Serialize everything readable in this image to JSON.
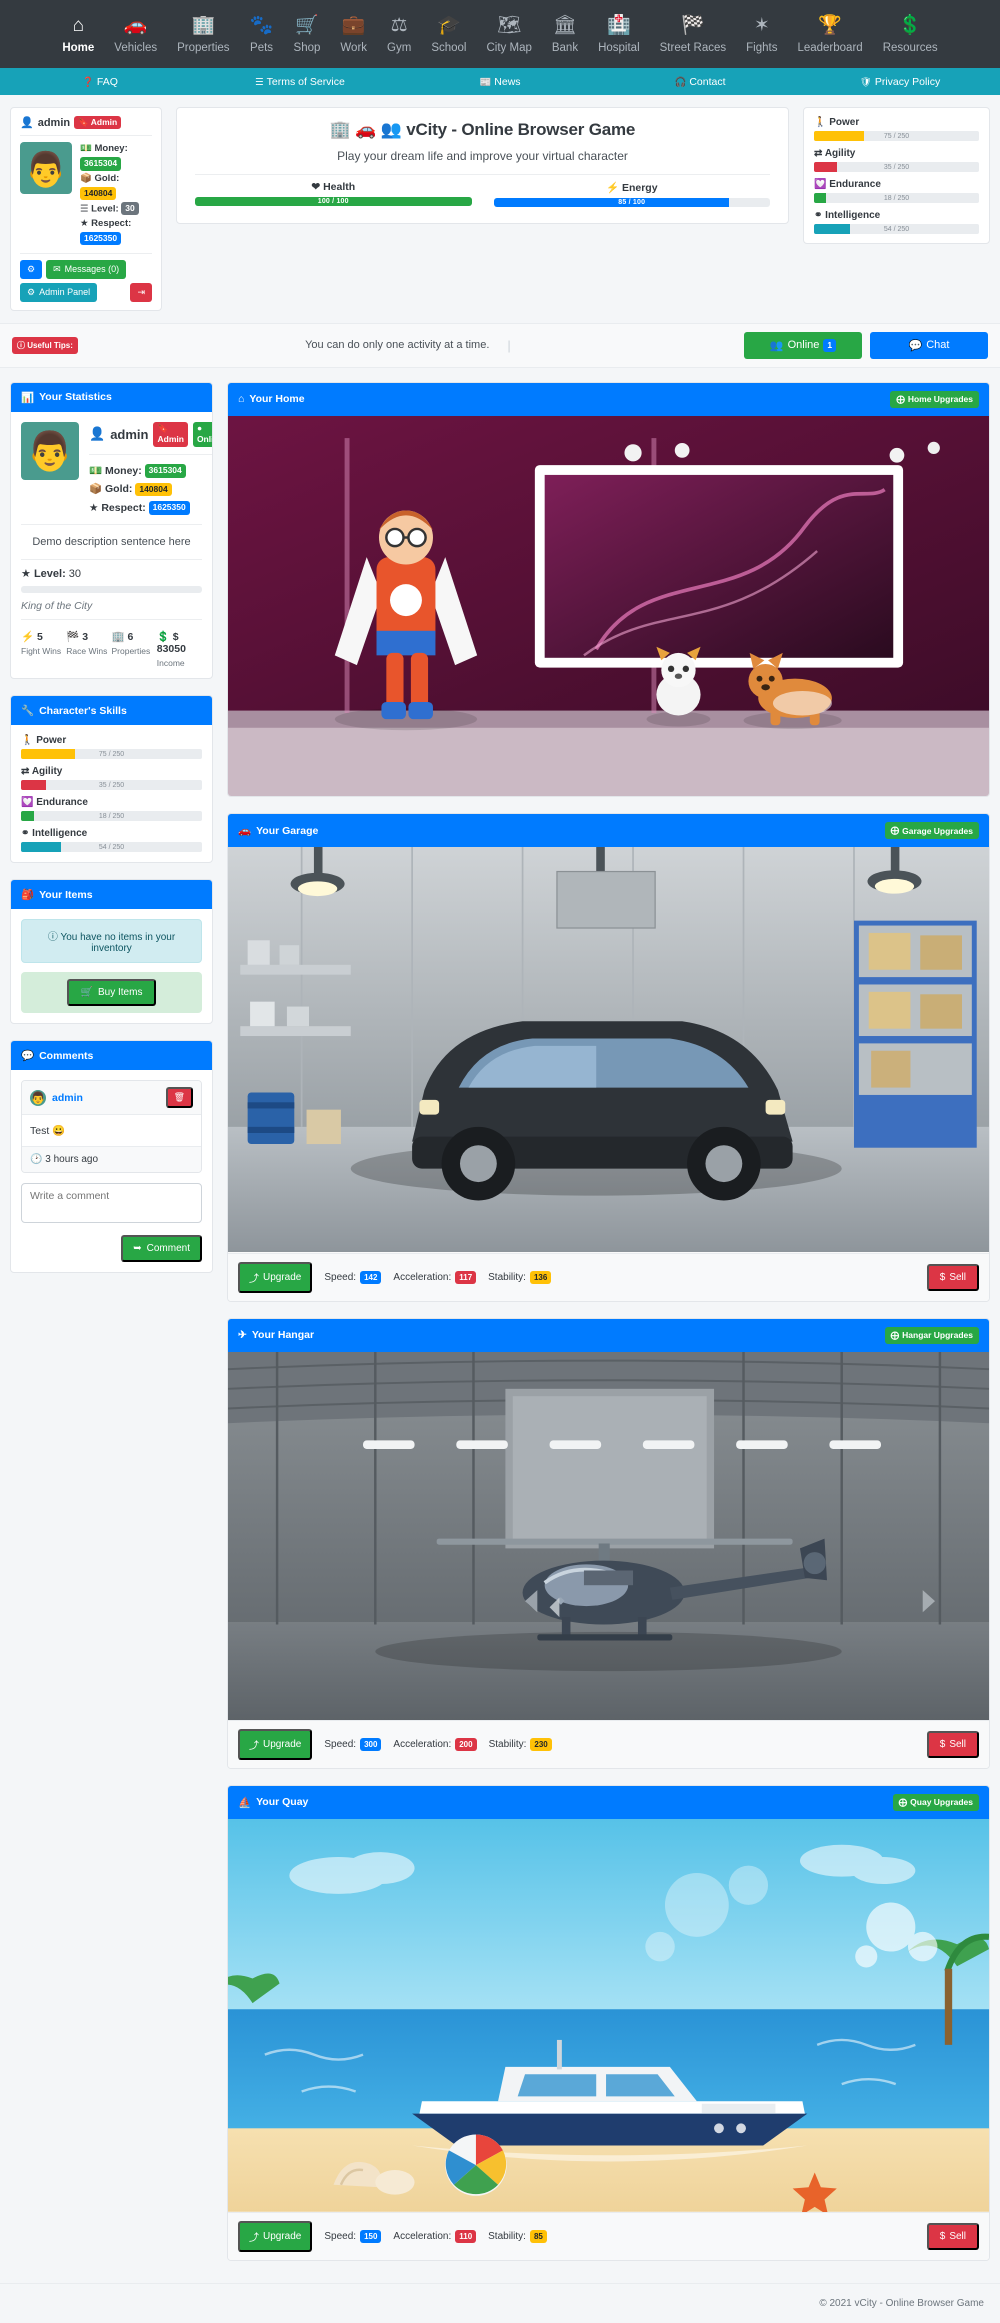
{
  "nav": {
    "items": [
      {
        "label": "Home",
        "icon": "home-icon",
        "active": true
      },
      {
        "label": "Vehicles",
        "icon": "car-icon",
        "active": false
      },
      {
        "label": "Properties",
        "icon": "building-icon",
        "active": false
      },
      {
        "label": "Pets",
        "icon": "paw-icon",
        "active": false
      },
      {
        "label": "Shop",
        "icon": "cart-icon",
        "active": false
      },
      {
        "label": "Work",
        "icon": "briefcase-icon",
        "active": false
      },
      {
        "label": "Gym",
        "icon": "dumbbell-icon",
        "active": false
      },
      {
        "label": "School",
        "icon": "graduation-cap-icon",
        "active": false
      },
      {
        "label": "City Map",
        "icon": "map-icon",
        "active": false
      },
      {
        "label": "Bank",
        "icon": "bank-icon",
        "active": false
      },
      {
        "label": "Hospital",
        "icon": "hospital-icon",
        "active": false
      },
      {
        "label": "Street Races",
        "icon": "checkered-flag-icon",
        "active": false
      },
      {
        "label": "Fights",
        "icon": "fist-icon",
        "active": false
      },
      {
        "label": "Leaderboard",
        "icon": "trophy-icon",
        "active": false
      },
      {
        "label": "Resources",
        "icon": "dollar-icon",
        "active": false
      }
    ]
  },
  "subnav": {
    "items": [
      {
        "label": "FAQ",
        "icon": "question-circle-icon"
      },
      {
        "label": "Terms of Service",
        "icon": "list-icon"
      },
      {
        "label": "News",
        "icon": "newspaper-icon"
      },
      {
        "label": "Contact",
        "icon": "support-icon"
      },
      {
        "label": "Privacy Policy",
        "icon": "user-shield-icon"
      }
    ]
  },
  "user_card": {
    "username": "admin",
    "admin_badge": "Admin",
    "money_label": "Money:",
    "money_value": "3615304",
    "gold_label": "Gold:",
    "gold_value": "140804",
    "level_label": "Level:",
    "level_value": "30",
    "respect_label": "Respect:",
    "respect_value": "1625350",
    "settings_label": "",
    "messages_label": "Messages (0)",
    "admin_panel_label": "Admin Panel",
    "logout_label": ""
  },
  "title_card": {
    "title": "vCity - Online Browser Game",
    "subtitle": "Play your dream life and improve your virtual character",
    "bars": [
      {
        "label": "Health",
        "icon": "heart-icon",
        "text": "100 / 100",
        "value": 100,
        "max": 100,
        "color": "#28a745"
      },
      {
        "label": "Energy",
        "icon": "bolt-icon",
        "text": "85 / 100",
        "value": 85,
        "max": 100,
        "color": "#007bff"
      }
    ]
  },
  "skills_header": {
    "items": [
      {
        "label": "Power",
        "icon": "person-icon",
        "text": "75 / 250",
        "value": 75,
        "max": 250,
        "color": "#ffc107"
      },
      {
        "label": "Agility",
        "icon": "exchange-icon",
        "text": "35 / 250",
        "value": 35,
        "max": 250,
        "color": "#dc3545"
      },
      {
        "label": "Endurance",
        "icon": "heartbeat-icon",
        "text": "18 / 250",
        "value": 18,
        "max": 250,
        "color": "#28a745"
      },
      {
        "label": "Intelligence",
        "icon": "sitemap-icon",
        "text": "54 / 250",
        "value": 54,
        "max": 250,
        "color": "#17a2b8"
      }
    ]
  },
  "tips": {
    "badge": "Useful Tips:",
    "text": "You can do only one activity at a time.",
    "online_label": "Online",
    "online_count": "1",
    "chat_label": "Chat"
  },
  "statistics": {
    "card_title": "Your Statistics",
    "username": "admin",
    "admin_badge": "Admin",
    "online_badge": "Online",
    "money_label": "Money:",
    "money_value": "3615304",
    "gold_label": "Gold:",
    "gold_value": "140804",
    "respect_label": "Respect:",
    "respect_value": "1625350",
    "description": "Demo description sentence here",
    "level_label": "Level:",
    "level_value": "30",
    "level_title": "King of the City",
    "quad": [
      {
        "value": "5",
        "label": "Fight Wins",
        "icon": "bolt-icon"
      },
      {
        "value": "3",
        "label": "Race Wins",
        "icon": "flag-icon"
      },
      {
        "value": "6",
        "label": "Properties",
        "icon": "building-icon"
      },
      {
        "value": "83050",
        "label": "Income",
        "icon": "dollar-icon"
      }
    ]
  },
  "skills_card": {
    "card_title": "Character's Skills",
    "items": [
      {
        "label": "Power",
        "icon": "person-icon",
        "text": "75 / 250",
        "value": 75,
        "max": 250,
        "color": "#ffc107"
      },
      {
        "label": "Agility",
        "icon": "exchange-icon",
        "text": "35 / 250",
        "value": 35,
        "max": 250,
        "color": "#dc3545"
      },
      {
        "label": "Endurance",
        "icon": "heartbeat-icon",
        "text": "18 / 250",
        "value": 18,
        "max": 250,
        "color": "#28a745"
      },
      {
        "label": "Intelligence",
        "icon": "sitemap-icon",
        "text": "54 / 250",
        "value": 54,
        "max": 250,
        "color": "#17a2b8"
      }
    ]
  },
  "items_card": {
    "card_title": "Your Items",
    "empty_text": "You have no items in your inventory",
    "buy_label": "Buy Items"
  },
  "comments_card": {
    "card_title": "Comments",
    "comment_author": "admin",
    "comment_text": "Test 😀",
    "comment_time": "3 hours ago",
    "input_placeholder": "Write a comment",
    "submit_label": "Comment",
    "delete_label": ""
  },
  "assets": [
    {
      "card_title": "Your Home",
      "icon": "home-icon",
      "upgrades_label": "Home Upgrades",
      "image": "home-scene",
      "has_footer": false
    },
    {
      "card_title": "Your Garage",
      "icon": "car-icon",
      "upgrades_label": "Garage Upgrades",
      "image": "garage-scene",
      "has_footer": true,
      "upgrade_label": "Upgrade",
      "sell_label": "Sell",
      "stats": [
        {
          "label": "Speed:",
          "value": "142",
          "color": "#007bff"
        },
        {
          "label": "Acceleration:",
          "value": "117",
          "color": "#dc3545"
        },
        {
          "label": "Stability:",
          "value": "136",
          "color": "#ffc107"
        }
      ]
    },
    {
      "card_title": "Your Hangar",
      "icon": "plane-icon",
      "upgrades_label": "Hangar Upgrades",
      "image": "hangar-scene",
      "has_footer": true,
      "upgrade_label": "Upgrade",
      "sell_label": "Sell",
      "stats": [
        {
          "label": "Speed:",
          "value": "300",
          "color": "#007bff"
        },
        {
          "label": "Acceleration:",
          "value": "200",
          "color": "#dc3545"
        },
        {
          "label": "Stability:",
          "value": "230",
          "color": "#ffc107"
        }
      ]
    },
    {
      "card_title": "Your Quay",
      "icon": "ship-icon",
      "upgrades_label": "Quay Upgrades",
      "image": "quay-scene",
      "has_footer": true,
      "upgrade_label": "Upgrade",
      "sell_label": "Sell",
      "stats": [
        {
          "label": "Speed:",
          "value": "150",
          "color": "#007bff"
        },
        {
          "label": "Acceleration:",
          "value": "110",
          "color": "#dc3545"
        },
        {
          "label": "Stability:",
          "value": "85",
          "color": "#ffc107"
        }
      ]
    }
  ],
  "footer": {
    "text": "© 2021 vCity - Online Browser Game"
  },
  "colors": {
    "primary": "#007bff",
    "dark": "#343a40",
    "teal": "#17a2b8",
    "success": "#28a745",
    "danger": "#dc3545",
    "warning": "#ffc107"
  }
}
